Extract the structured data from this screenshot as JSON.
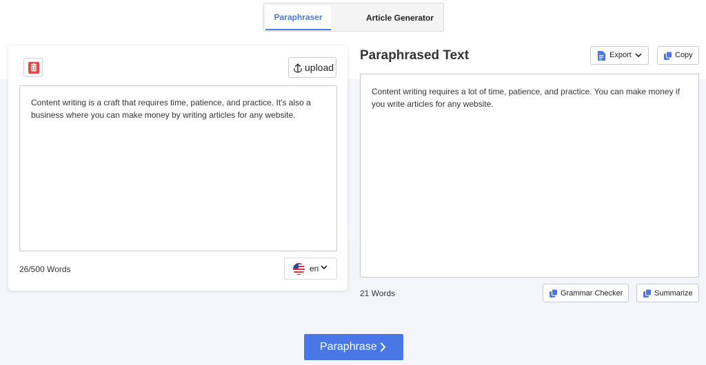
{
  "tabs": [
    {
      "label": "Paraphraser",
      "active": true
    },
    {
      "label": "Article Generator",
      "active": false
    }
  ],
  "input": {
    "upload_label": "upload",
    "text": "Content writing is a craft that requires time, patience, and practice. It's also a business where you can make money by writing articles for any website.",
    "word_count": "26/500 Words",
    "language": "en"
  },
  "output": {
    "title": "Paraphrased Text",
    "export_label": "Export",
    "copy_label": "Copy",
    "text": "Content writing requires a lot of time, patience, and practice. You can make money if you write articles for any website.",
    "word_count": "21 Words",
    "grammar_label": "Grammar Checker",
    "summarize_label": "Summarize"
  },
  "action": {
    "paraphrase_label": "Paraphrase"
  },
  "colors": {
    "accent": "#4a77e6",
    "delete": "#e8484b"
  }
}
